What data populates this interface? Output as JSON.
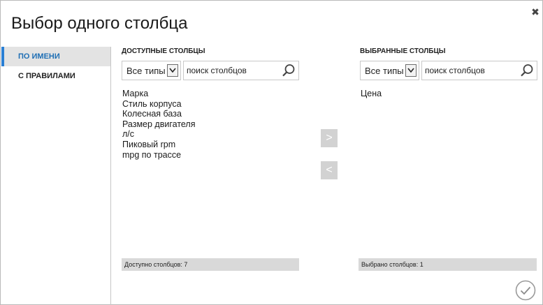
{
  "dialog": {
    "title": "Выбор одного столбца",
    "close_icon": "close-icon",
    "ok_icon": "checkmark-circle-icon"
  },
  "sidebar": {
    "items": [
      {
        "label": "По имени",
        "active": true
      },
      {
        "label": "С правилами",
        "active": false
      }
    ]
  },
  "available": {
    "header": "Доступные столбцы",
    "type_filter": "Все типы",
    "search_placeholder": "поиск столбцов",
    "items": [
      "Марка",
      "Стиль корпуса",
      "Колесная база",
      "Размер двигателя",
      "л/с",
      "Пиковый rpm",
      "mpg по трассе"
    ],
    "status": "Доступно столбцов: 7"
  },
  "selected": {
    "header": "Выбранные столбцы",
    "type_filter": "Все типы",
    "search_placeholder": "поиск столбцов",
    "items": [
      "Цена"
    ],
    "status": "Выбрано столбцов: 1"
  },
  "buttons": {
    "add": ">",
    "remove": "<"
  },
  "colors": {
    "accent": "#2a7fd4",
    "status_bar": "#d9d9d9",
    "move_button": "#d2d2d2"
  }
}
